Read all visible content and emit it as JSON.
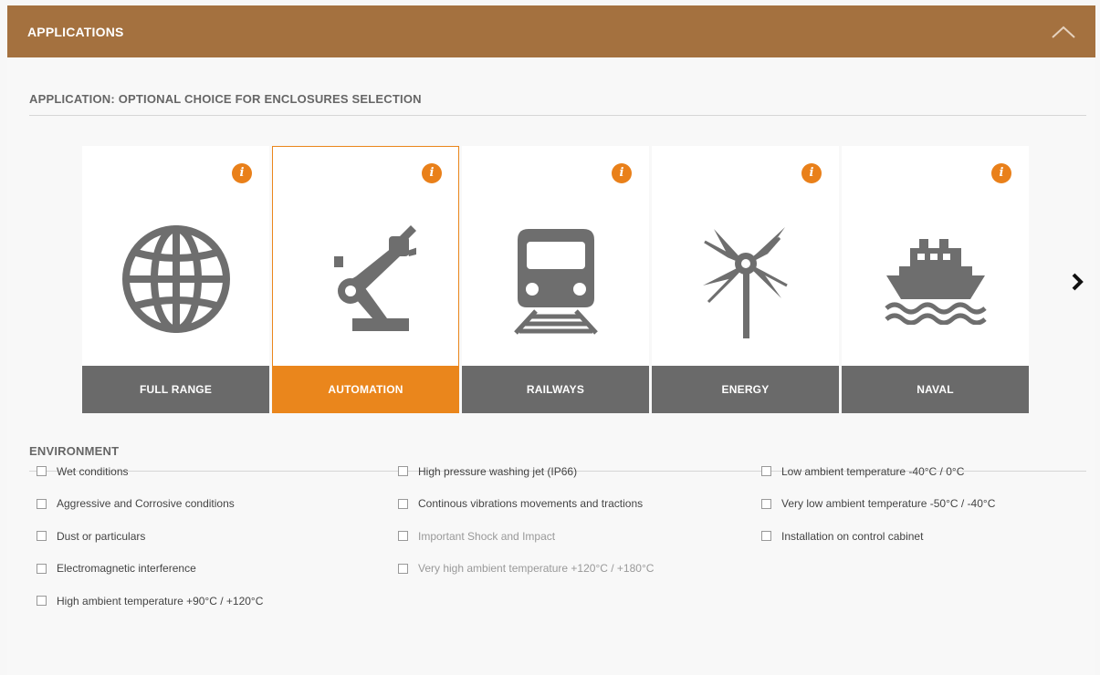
{
  "header": {
    "title": "APPLICATIONS"
  },
  "application_section": {
    "title": "APPLICATION: OPTIONAL CHOICE FOR ENCLOSURES SELECTION"
  },
  "cards": [
    {
      "label": "FULL RANGE",
      "icon": "globe-icon",
      "selected": false
    },
    {
      "label": "AUTOMATION",
      "icon": "robot-arm-icon",
      "selected": true
    },
    {
      "label": "RAILWAYS",
      "icon": "train-icon",
      "selected": false
    },
    {
      "label": "ENERGY",
      "icon": "wind-turbine-icon",
      "selected": false
    },
    {
      "label": "NAVAL",
      "icon": "ship-icon",
      "selected": false
    }
  ],
  "environment_section": {
    "title": "ENVIRONMENT"
  },
  "environment": {
    "col1": [
      "Wet conditions",
      "Aggressive and Corrosive conditions",
      "Dust or particulars",
      "Electromagnetic interference",
      "High ambient temperature +90°C / +120°C"
    ],
    "col2": [
      "High pressure washing jet (IP66)",
      "Continous vibrations movements and tractions",
      "Important Shock and Impact",
      "Very high ambient temperature +120°C / +180°C"
    ],
    "col3": [
      "Low ambient temperature -40°C / 0°C",
      "Very low ambient temperature -50°C / -40°C",
      "Installation on control cabinet"
    ]
  },
  "colors": {
    "header": "#a4713f",
    "accent": "#ea861c",
    "label_bg": "#6a6a6a",
    "icon": "#6e6e6e"
  }
}
